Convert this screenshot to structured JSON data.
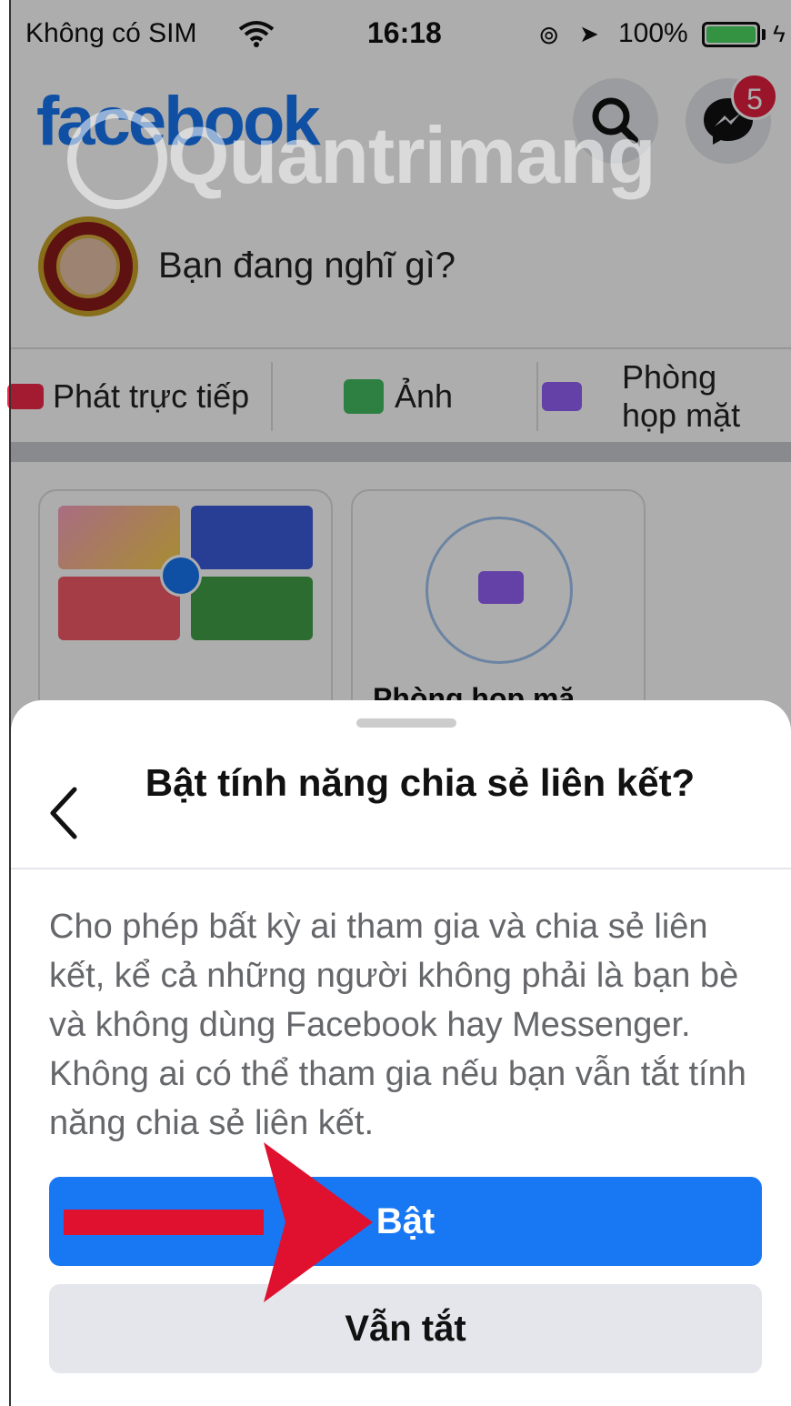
{
  "status_bar": {
    "carrier": "Không có SIM",
    "time": "16:18",
    "battery_percent": "100%"
  },
  "header": {
    "logo": "facebook",
    "messenger_badge": "5",
    "icons": [
      "search-icon",
      "messenger-icon"
    ]
  },
  "watermark": {
    "text": "Quantrimang"
  },
  "composer": {
    "placeholder": "Bạn đang nghĩ gì?"
  },
  "actions": {
    "live_label": "Phát trực tiếp",
    "photo_label": "Ảnh",
    "room_label_line1": "Phòng",
    "room_label_line2": "họp mặt"
  },
  "cards": {
    "room_label": "Phòng họp mặ"
  },
  "sheet": {
    "title": "Bật tính năng chia sẻ liên kết?",
    "body": "Cho phép bất kỳ ai tham gia và chia sẻ liên kết, kể cả những người không phải là bạn bè và không dùng Facebook hay Messenger. Không ai có thể tham gia nếu bạn vẫn tắt tính năng chia sẻ liên kết.",
    "primary_button": "Bật",
    "secondary_button": "Vẫn tắt"
  },
  "colors": {
    "facebook_blue": "#1877f2",
    "annotation_red": "#e0102f",
    "battery_green": "#4cd964",
    "badge_red": "#e41e3f"
  }
}
